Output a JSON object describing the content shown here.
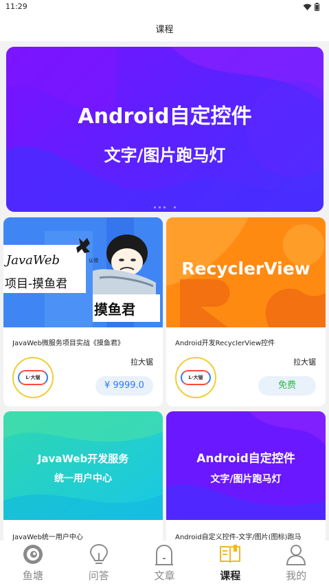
{
  "status": {
    "time": "11:29"
  },
  "header": {
    "title": "课程"
  },
  "banner": {
    "title": "Android自定控件",
    "subtitle": "文字/图片跑马灯"
  },
  "courses": [
    {
      "cover": {
        "line1": "JavaWeb",
        "line2": "项目-摸鱼君",
        "line3": "摸鱼君",
        "badge": "认领"
      },
      "title": "JavaWeb微服务项目实战《摸鱼君》",
      "teacher": "拉大锯",
      "avatar_text": "L·大锯",
      "price": "¥ 9999.0",
      "price_color": "#2d7bf0"
    },
    {
      "cover": {
        "line1": "RecyclerView"
      },
      "title": "Android开发RecyclerView控件",
      "teacher": "拉大锯",
      "avatar_text": "L·大锯",
      "price": "免费",
      "price_color": "#2fb84a"
    },
    {
      "cover": {
        "line1": "JavaWeb开发服务",
        "line2": "统一用户中心"
      },
      "title": "JavaWeb统一用户中心"
    },
    {
      "cover": {
        "line1": "Android自定控件",
        "line2": "文字/图片跑马灯"
      },
      "title": "Android自定义控件-文字/图片(图标)跑马"
    }
  ],
  "tabs": [
    {
      "label": "鱼塘",
      "icon": "fish-pond-icon"
    },
    {
      "label": "问答",
      "icon": "lightbulb-icon"
    },
    {
      "label": "文章",
      "icon": "tombstone-icon"
    },
    {
      "label": "课程",
      "icon": "book-icon",
      "active": true
    },
    {
      "label": "我的",
      "icon": "person-icon"
    }
  ],
  "colors": {
    "accent": "#f3b822",
    "banner": "#6a18ff"
  }
}
